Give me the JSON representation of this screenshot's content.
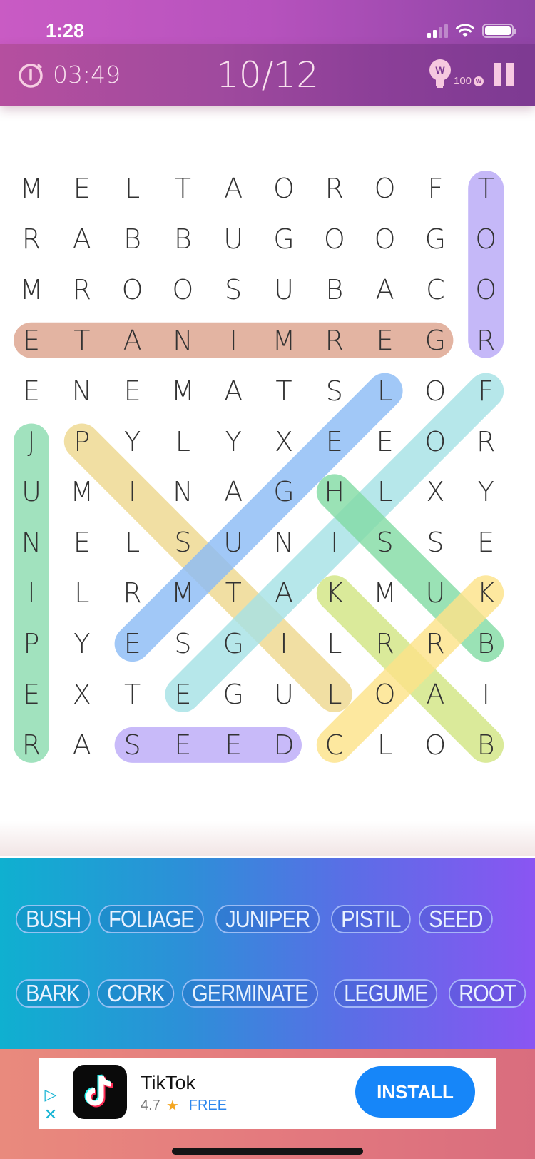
{
  "status_bar": {
    "time": "1:28",
    "signal_bars": 2,
    "signal_total": 4
  },
  "header": {
    "timer": "03:49",
    "progress": "10/12",
    "hint_letter": "W",
    "hint_count": "100",
    "coin_letter": "W"
  },
  "grid": {
    "rows": [
      [
        "M",
        "E",
        "L",
        "T",
        "A",
        "O",
        "R",
        "O",
        "F",
        "T"
      ],
      [
        "R",
        "A",
        "B",
        "B",
        "U",
        "G",
        "O",
        "O",
        "G",
        "O"
      ],
      [
        "M",
        "R",
        "O",
        "O",
        "S",
        "U",
        "B",
        "A",
        "C",
        "O"
      ],
      [
        "E",
        "T",
        "A",
        "N",
        "I",
        "M",
        "R",
        "E",
        "G",
        "R"
      ],
      [
        "E",
        "N",
        "E",
        "M",
        "A",
        "T",
        "S",
        "L",
        "O",
        "F"
      ],
      [
        "J",
        "P",
        "Y",
        "L",
        "Y",
        "X",
        "E",
        "E",
        "O",
        "R"
      ],
      [
        "U",
        "M",
        "I",
        "N",
        "A",
        "G",
        "H",
        "L",
        "X",
        "Y"
      ],
      [
        "N",
        "E",
        "L",
        "S",
        "U",
        "N",
        "I",
        "S",
        "S",
        "E"
      ],
      [
        "I",
        "L",
        "R",
        "M",
        "T",
        "A",
        "K",
        "M",
        "U",
        "K"
      ],
      [
        "P",
        "Y",
        "E",
        "S",
        "G",
        "I",
        "L",
        "R",
        "R",
        "B"
      ],
      [
        "E",
        "X",
        "T",
        "E",
        "G",
        "U",
        "L",
        "O",
        "A",
        "I"
      ],
      [
        "R",
        "A",
        "S",
        "E",
        "E",
        "D",
        "C",
        "L",
        "O",
        "B"
      ]
    ],
    "found": [
      {
        "word": "ROOT",
        "start": [
          3,
          9
        ],
        "end": [
          0,
          9
        ],
        "color": "#b9a9f7"
      },
      {
        "word": "GERMINATE",
        "start": [
          3,
          8
        ],
        "end": [
          3,
          0
        ],
        "color": "#dea48e"
      },
      {
        "word": "JUNIPER",
        "start": [
          5,
          0
        ],
        "end": [
          11,
          0
        ],
        "color": "#8ddcb0"
      },
      {
        "word": "PISTIL",
        "start": [
          5,
          1
        ],
        "end": [
          10,
          6
        ],
        "color": "#efd98f"
      },
      {
        "word": "LEGUME",
        "start": [
          4,
          7
        ],
        "end": [
          9,
          2
        ],
        "color": "#8dbcf6"
      },
      {
        "word": "FOLIAGE",
        "start": [
          4,
          9
        ],
        "end": [
          10,
          3
        ],
        "color": "#a7e2e6"
      },
      {
        "word": "BUSH",
        "start": [
          9,
          9
        ],
        "end": [
          6,
          6
        ],
        "color": "#84dca6"
      },
      {
        "word": "BARK",
        "start": [
          11,
          9
        ],
        "end": [
          8,
          6
        ],
        "color": "#d3e685"
      },
      {
        "word": "CORK",
        "start": [
          11,
          6
        ],
        "end": [
          8,
          9
        ],
        "color": "#fde38a"
      },
      {
        "word": "SEED",
        "start": [
          11,
          2
        ],
        "end": [
          11,
          5
        ],
        "color": "#bcacf8"
      }
    ]
  },
  "word_list": {
    "row1": [
      "BUSH",
      "FOLIAGE",
      "JUNIPER",
      "PISTIL",
      "SEED"
    ],
    "row2": [
      "BARK",
      "CORK",
      "GERMINATE",
      "LEGUME",
      "ROOT"
    ]
  },
  "ad": {
    "app_name": "TikTok",
    "rating": "4.7",
    "star": "★",
    "price": "FREE",
    "install_label": "INSTALL",
    "adchoices_icon": "▷",
    "close_icon": "✕"
  }
}
